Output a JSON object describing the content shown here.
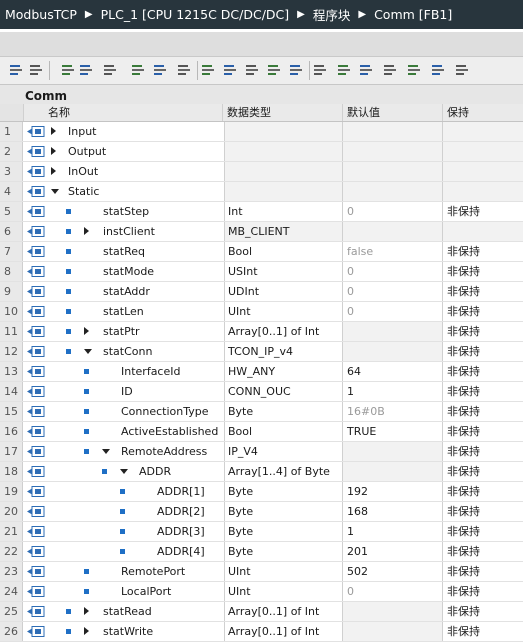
{
  "breadcrumb": [
    "ModbusTCP",
    "PLC_1 [CPU 1215C DC/DC/DC]",
    "程序块",
    "Comm [FB1]"
  ],
  "block_title": "Comm",
  "columns": {
    "name": "名称",
    "type": "数据类型",
    "default": "默认值",
    "retain": "保持"
  },
  "toolbar_icons": [
    "insert-row-icon",
    "add-row-icon",
    "declaration-icon",
    "monitor-icon",
    "list-icon",
    "symbol-list-icon",
    "calc-icon",
    "pen-icon",
    "connect-icon",
    "network-icon",
    "cam-icon",
    "snapshot-icon",
    "table-icon",
    "load-icon",
    "indent-icon",
    "outdent-icon",
    "align-icon",
    "compare-icon",
    "sort-icon",
    "arrow-icon"
  ],
  "rows": [
    {
      "n": "1",
      "name": "Input",
      "level": 0,
      "exp": "r",
      "bullet": false,
      "type": "",
      "def": "",
      "ret": "",
      "def_grey": false,
      "shade": true
    },
    {
      "n": "2",
      "name": "Output",
      "level": 0,
      "exp": "r",
      "bullet": false,
      "type": "",
      "def": "",
      "ret": "",
      "def_grey": false,
      "shade": true
    },
    {
      "n": "3",
      "name": "InOut",
      "level": 0,
      "exp": "r",
      "bullet": false,
      "type": "",
      "def": "",
      "ret": "",
      "def_grey": false,
      "shade": true
    },
    {
      "n": "4",
      "name": "Static",
      "level": 0,
      "exp": "d",
      "bullet": false,
      "type": "",
      "def": "",
      "ret": "",
      "def_grey": false,
      "shade": true
    },
    {
      "n": "5",
      "name": "statStep",
      "level": 1,
      "exp": "",
      "bullet": true,
      "type": "Int",
      "def": "0",
      "ret": "非保持",
      "def_grey": true,
      "shade": false
    },
    {
      "n": "6",
      "name": "instClient",
      "level": 1,
      "exp": "r",
      "bullet": true,
      "type": "MB_CLIENT",
      "def": "",
      "ret": "",
      "def_grey": false,
      "shade": true
    },
    {
      "n": "7",
      "name": "statReq",
      "level": 1,
      "exp": "",
      "bullet": true,
      "type": "Bool",
      "def": "false",
      "ret": "非保持",
      "def_grey": true,
      "shade": false
    },
    {
      "n": "8",
      "name": "statMode",
      "level": 1,
      "exp": "",
      "bullet": true,
      "type": "USInt",
      "def": "0",
      "ret": "非保持",
      "def_grey": true,
      "shade": false
    },
    {
      "n": "9",
      "name": "statAddr",
      "level": 1,
      "exp": "",
      "bullet": true,
      "type": "UDInt",
      "def": "0",
      "ret": "非保持",
      "def_grey": true,
      "shade": false
    },
    {
      "n": "10",
      "name": "statLen",
      "level": 1,
      "exp": "",
      "bullet": true,
      "type": "UInt",
      "def": "0",
      "ret": "非保持",
      "def_grey": true,
      "shade": false
    },
    {
      "n": "11",
      "name": "statPtr",
      "level": 1,
      "exp": "r",
      "bullet": true,
      "type": "Array[0..1] of Int",
      "def": "",
      "ret": "非保持",
      "def_grey": false,
      "shade": false
    },
    {
      "n": "12",
      "name": "statConn",
      "level": 1,
      "exp": "d",
      "bullet": true,
      "type": "TCON_IP_v4",
      "def": "",
      "ret": "非保持",
      "def_grey": false,
      "shade": false
    },
    {
      "n": "13",
      "name": "InterfaceId",
      "level": 2,
      "exp": "",
      "bullet": true,
      "type": "HW_ANY",
      "def": "64",
      "ret": "非保持",
      "def_grey": false,
      "shade": false
    },
    {
      "n": "14",
      "name": "ID",
      "level": 2,
      "exp": "",
      "bullet": true,
      "type": "CONN_OUC",
      "def": "1",
      "ret": "非保持",
      "def_grey": false,
      "shade": false
    },
    {
      "n": "15",
      "name": "ConnectionType",
      "level": 2,
      "exp": "",
      "bullet": true,
      "type": "Byte",
      "def": "16#0B",
      "ret": "非保持",
      "def_grey": true,
      "shade": false
    },
    {
      "n": "16",
      "name": "ActiveEstablished",
      "level": 2,
      "exp": "",
      "bullet": true,
      "type": "Bool",
      "def": "TRUE",
      "ret": "非保持",
      "def_grey": false,
      "shade": false
    },
    {
      "n": "17",
      "name": "RemoteAddress",
      "level": 2,
      "exp": "d",
      "bullet": true,
      "type": "IP_V4",
      "def": "",
      "ret": "非保持",
      "def_grey": false,
      "shade": false
    },
    {
      "n": "18",
      "name": "ADDR",
      "level": 3,
      "exp": "d",
      "bullet": true,
      "type": "Array[1..4] of Byte",
      "def": "",
      "ret": "非保持",
      "def_grey": false,
      "shade": false
    },
    {
      "n": "19",
      "name": "ADDR[1]",
      "level": 4,
      "exp": "",
      "bullet": true,
      "type": "Byte",
      "def": "192",
      "ret": "非保持",
      "def_grey": false,
      "shade": false
    },
    {
      "n": "20",
      "name": "ADDR[2]",
      "level": 4,
      "exp": "",
      "bullet": true,
      "type": "Byte",
      "def": "168",
      "ret": "非保持",
      "def_grey": false,
      "shade": false
    },
    {
      "n": "21",
      "name": "ADDR[3]",
      "level": 4,
      "exp": "",
      "bullet": true,
      "type": "Byte",
      "def": "1",
      "ret": "非保持",
      "def_grey": false,
      "shade": false
    },
    {
      "n": "22",
      "name": "ADDR[4]",
      "level": 4,
      "exp": "",
      "bullet": true,
      "type": "Byte",
      "def": "201",
      "ret": "非保持",
      "def_grey": false,
      "shade": false
    },
    {
      "n": "23",
      "name": "RemotePort",
      "level": 2,
      "exp": "",
      "bullet": true,
      "type": "UInt",
      "def": "502",
      "ret": "非保持",
      "def_grey": false,
      "shade": false
    },
    {
      "n": "24",
      "name": "LocalPort",
      "level": 2,
      "exp": "",
      "bullet": true,
      "type": "UInt",
      "def": "0",
      "ret": "非保持",
      "def_grey": true,
      "shade": false
    },
    {
      "n": "25",
      "name": "statRead",
      "level": 1,
      "exp": "r",
      "bullet": true,
      "type": "Array[0..1] of Int",
      "def": "",
      "ret": "非保持",
      "def_grey": false,
      "shade": false
    },
    {
      "n": "26",
      "name": "statWrite",
      "level": 1,
      "exp": "r",
      "bullet": true,
      "type": "Array[0..1] of Int",
      "def": "",
      "ret": "非保持",
      "def_grey": false,
      "shade": false
    }
  ]
}
